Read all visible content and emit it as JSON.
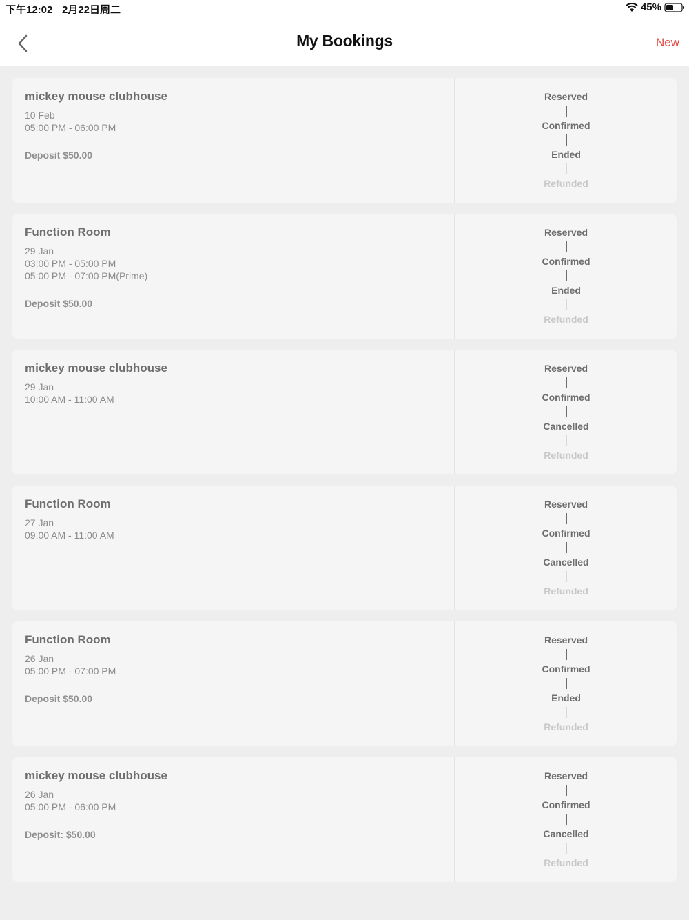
{
  "status_bar": {
    "time": "下午12:02",
    "date": "2月22日周二",
    "battery": "45%"
  },
  "header": {
    "title": "My Bookings",
    "new_label": "New",
    "accent_color": "#e14b43"
  },
  "statuses": {
    "reserved": "Reserved",
    "confirmed": "Confirmed",
    "ended": "Ended",
    "cancelled": "Cancelled",
    "refunded": "Refunded"
  },
  "bookings": [
    {
      "title": "mickey mouse clubhouse",
      "date": "10 Feb",
      "times": [
        "05:00 PM - 06:00 PM",
        ""
      ],
      "deposit": "Deposit $50.00",
      "third_status": "Ended"
    },
    {
      "title": "Function Room",
      "date": "29 Jan",
      "times": [
        "03:00 PM - 05:00 PM",
        "05:00 PM - 07:00 PM(Prime)"
      ],
      "deposit": "Deposit $50.00",
      "third_status": "Ended"
    },
    {
      "title": "mickey mouse clubhouse",
      "date": "29 Jan",
      "times": [
        "10:00 AM - 11:00 AM",
        ""
      ],
      "deposit": "",
      "third_status": "Cancelled"
    },
    {
      "title": "Function Room",
      "date": "27 Jan",
      "times": [
        "09:00 AM - 11:00 AM",
        ""
      ],
      "deposit": "",
      "third_status": "Cancelled"
    },
    {
      "title": "Function Room",
      "date": "26 Jan",
      "times": [
        "05:00 PM - 07:00 PM",
        ""
      ],
      "deposit": "Deposit $50.00",
      "third_status": "Ended"
    },
    {
      "title": "mickey mouse clubhouse",
      "date": "26 Jan",
      "times": [
        "05:00 PM - 06:00 PM",
        ""
      ],
      "deposit": "Deposit: $50.00",
      "third_status": "Cancelled"
    }
  ]
}
